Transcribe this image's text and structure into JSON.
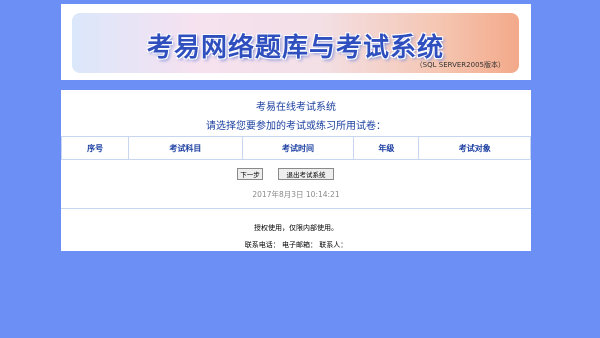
{
  "banner": {
    "title": "考易网络题库与考试系统",
    "subtitle": "（SQL SERVER2005版本）"
  },
  "main": {
    "heading": "考易在线考试系统",
    "instruction": "请选择您要参加的考试或练习所用试卷：",
    "table_headers": [
      "序号",
      "考试科目",
      "考试时间",
      "年级",
      "考试对象"
    ],
    "next_button": "下一步",
    "exit_button": "退出考试系统",
    "datetime": "2017年8月3日  10:14:21"
  },
  "footer": {
    "license": "授权使用，仅限内部使用。",
    "contact": "联系电话：  电子邮箱：  联系人："
  },
  "colors": {
    "page_background": "#6b8ff5",
    "heading_text": "#1b3fa0",
    "table_border": "#c8d6ef"
  }
}
